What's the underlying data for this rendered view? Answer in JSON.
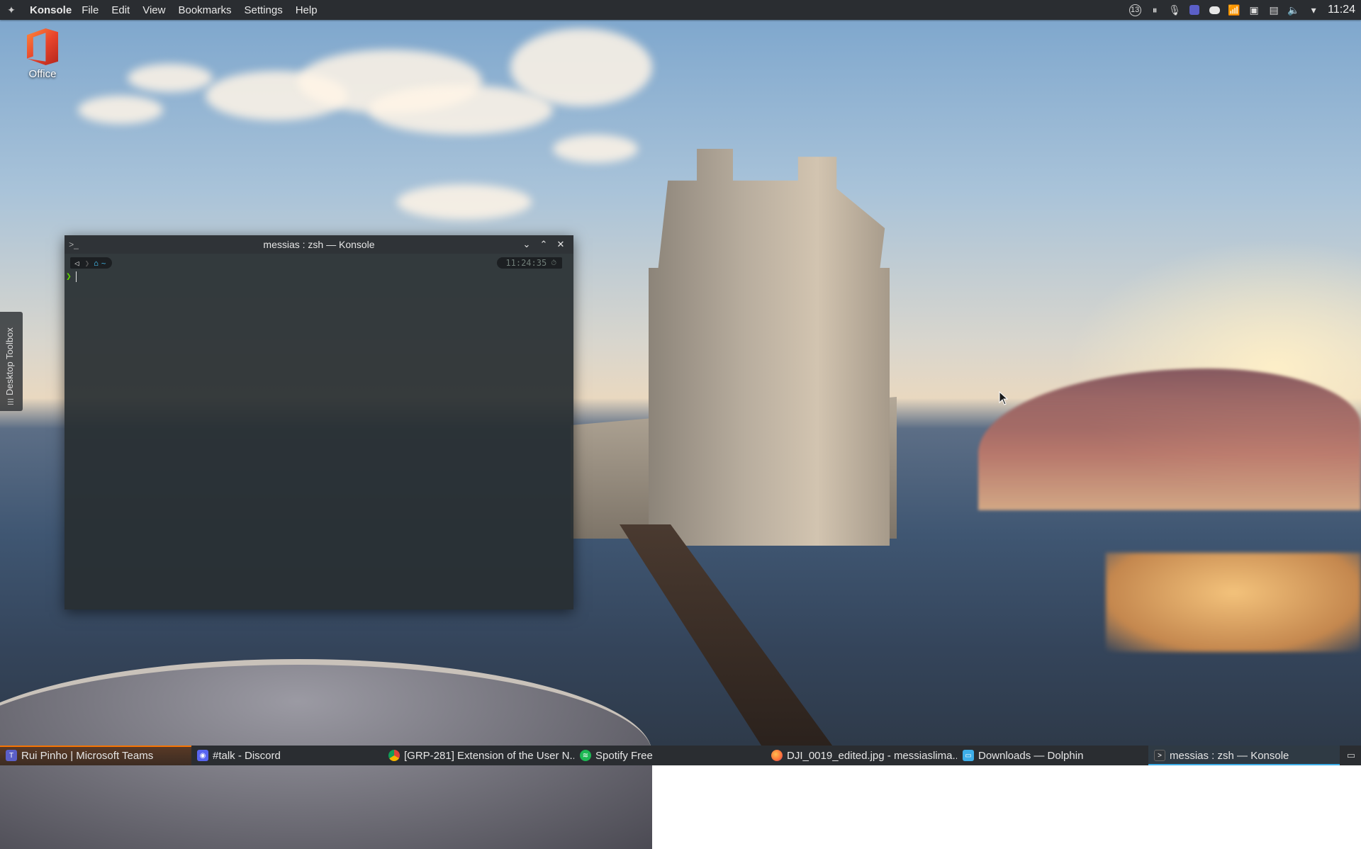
{
  "top_panel": {
    "app_name": "Konsole",
    "menu": [
      "File",
      "Edit",
      "View",
      "Bookmarks",
      "Settings",
      "Help"
    ],
    "tray": {
      "updates_badge": "13",
      "clock": "11:24"
    }
  },
  "desktop": {
    "icons": [
      {
        "label": "Office",
        "icon": "office-icon"
      }
    ],
    "toolbox_label": "Desktop Toolbox"
  },
  "konsole": {
    "title": "messias : zsh — Konsole",
    "prompt": {
      "os_glyph": "◁",
      "home_glyph": "⌂",
      "dir": "~",
      "time": "11:24:35",
      "prompt_char": "❯"
    }
  },
  "taskbar": {
    "tasks": [
      {
        "label": "Rui Pinho | Microsoft Teams",
        "icon": "teams-icon",
        "color": "#5b5fc7"
      },
      {
        "label": "#talk - Discord",
        "icon": "discord-icon",
        "color": "#5865f2"
      },
      {
        "label": "[GRP-281] Extension of the User N...",
        "icon": "chrome-icon",
        "color": "#4285f4"
      },
      {
        "label": "Spotify Free",
        "icon": "spotify-icon",
        "color": "#1db954"
      },
      {
        "label": "DJI_0019_edited.jpg - messiaslima....",
        "icon": "firefox-icon",
        "color": "#ff7139"
      },
      {
        "label": "Downloads — Dolphin",
        "icon": "dolphin-icon",
        "color": "#3daee9"
      },
      {
        "label": "messias : zsh — Konsole",
        "icon": "konsole-icon",
        "color": "#31363b"
      }
    ]
  },
  "colors": {
    "accent": "#3daee9",
    "attention": "#f67400",
    "panel_bg": "#2a2d31",
    "prompt_green": "#5fd700",
    "prompt_blue": "#3fa9d6"
  }
}
